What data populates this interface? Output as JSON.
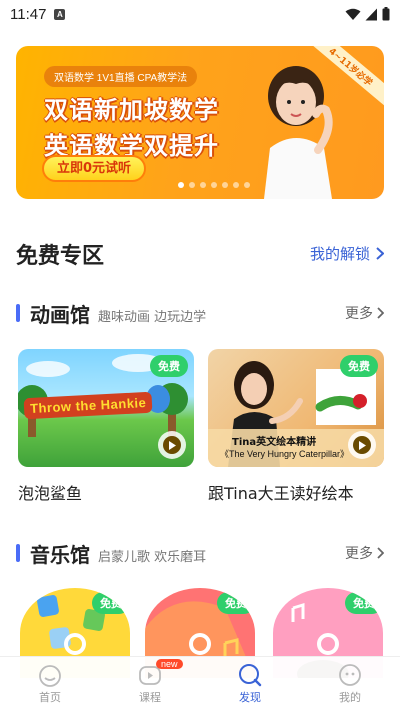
{
  "status_bar": {
    "time": "11:47",
    "notif_icon_letter": "A"
  },
  "banner": {
    "tags": "双语数学  1V1直播  CPA教学法",
    "headline_1": "双语新加坡数学",
    "headline_2": "英语数学双提升",
    "cta": "立即0元试听",
    "corner_tag": "4~11岁必学",
    "carousel_pages": 7,
    "carousel_active": 1
  },
  "free_zone": {
    "title": "免费专区",
    "unlock_link": "我的解锁"
  },
  "animation": {
    "title": "动画馆",
    "subtitle": "趣味动画 边玩边学",
    "more": "更多",
    "cards": [
      {
        "title": "泡泡鲨鱼",
        "badge": "免费",
        "thumb_text": "Throw the Hankie"
      },
      {
        "title": "跟Tina大王读好绘本",
        "badge": "免费",
        "thumb_caption_1": "Tina英文绘本精讲",
        "thumb_caption_2": "《The Very Hungry Caterpillar》"
      }
    ]
  },
  "music": {
    "title": "音乐馆",
    "subtitle": "启蒙儿歌 欢乐磨耳",
    "more": "更多",
    "cards": [
      {
        "badge": "免费"
      },
      {
        "badge": "免费"
      },
      {
        "badge": "免费"
      }
    ]
  },
  "bottom_nav": {
    "items": [
      {
        "label": "首页",
        "icon": "home-icon"
      },
      {
        "label": "课程",
        "icon": "course-icon",
        "badge": "new"
      },
      {
        "label": "发现",
        "icon": "discover-icon",
        "active": true
      },
      {
        "label": "我的",
        "icon": "profile-icon"
      }
    ]
  },
  "colors": {
    "accent": "#3a63d6",
    "section_bar": "#4a6cf7",
    "free_badge": "#2fcf6b",
    "banner": "#ffa31a"
  }
}
